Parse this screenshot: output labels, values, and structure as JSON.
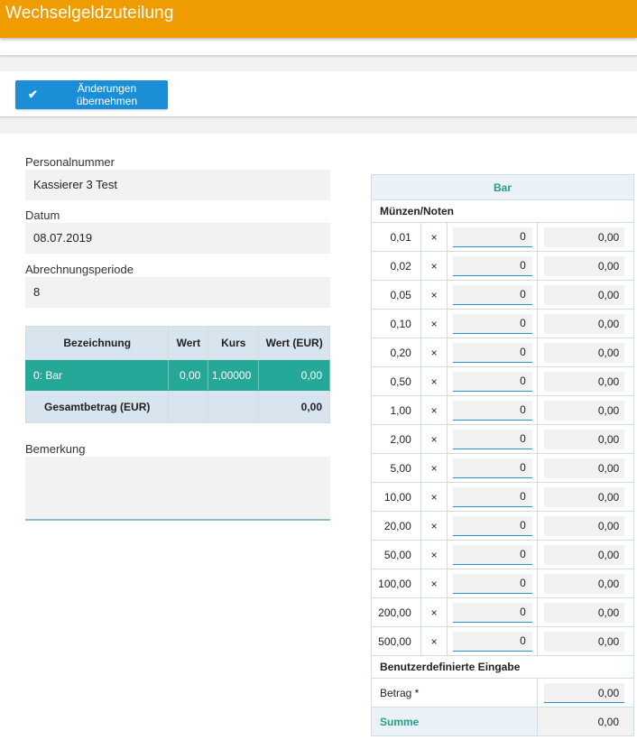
{
  "app": {
    "title": "Wechselgeldzuteilung"
  },
  "toolbar": {
    "apply_label": "Änderungen übernehmen",
    "apply_icon": "check-icon"
  },
  "form": {
    "personalnummer_label": "Personalnummer",
    "personalnummer_value": "Kassierer 3 Test",
    "datum_label": "Datum",
    "datum_value": "08.07.2019",
    "periode_label": "Abrechnungsperiode",
    "periode_value": "8",
    "bemerkung_label": "Bemerkung",
    "bemerkung_value": ""
  },
  "currency_table": {
    "headers": [
      "Bezeichnung",
      "Wert",
      "Kurs",
      "Wert (EUR)"
    ],
    "rows": [
      {
        "bezeichnung": "0: Bar",
        "wert": "0,00",
        "kurs": "1,00000",
        "wert_eur": "0,00"
      }
    ],
    "total_label": "Gesamtbetrag (EUR)",
    "total_value": "0,00"
  },
  "cash_table": {
    "header": "Bar",
    "section_label": "Münzen/Noten",
    "multiply_symbol": "×",
    "rows": [
      {
        "denomination": "0,01",
        "quantity": "0",
        "amount": "0,00"
      },
      {
        "denomination": "0,02",
        "quantity": "0",
        "amount": "0,00"
      },
      {
        "denomination": "0,05",
        "quantity": "0",
        "amount": "0,00"
      },
      {
        "denomination": "0,10",
        "quantity": "0",
        "amount": "0,00"
      },
      {
        "denomination": "0,20",
        "quantity": "0",
        "amount": "0,00"
      },
      {
        "denomination": "0,50",
        "quantity": "0",
        "amount": "0,00"
      },
      {
        "denomination": "1,00",
        "quantity": "0",
        "amount": "0,00"
      },
      {
        "denomination": "2,00",
        "quantity": "0",
        "amount": "0,00"
      },
      {
        "denomination": "5,00",
        "quantity": "0",
        "amount": "0,00"
      },
      {
        "denomination": "10,00",
        "quantity": "0",
        "amount": "0,00"
      },
      {
        "denomination": "20,00",
        "quantity": "0",
        "amount": "0,00"
      },
      {
        "denomination": "50,00",
        "quantity": "0",
        "amount": "0,00"
      },
      {
        "denomination": "100,00",
        "quantity": "0",
        "amount": "0,00"
      },
      {
        "denomination": "200,00",
        "quantity": "0",
        "amount": "0,00"
      },
      {
        "denomination": "500,00",
        "quantity": "0",
        "amount": "0,00"
      }
    ],
    "custom_section_label": "Benutzerdefinierte Eingabe",
    "betrag_label": "Betrag *",
    "betrag_value": "0,00",
    "summe_label": "Summe",
    "summe_value": "0,00"
  },
  "colors": {
    "header_bg": "#ef9c00",
    "button_bg": "#1a8fd8",
    "row_selected_bg": "#25a897",
    "accent_text": "#2a9a8c"
  }
}
